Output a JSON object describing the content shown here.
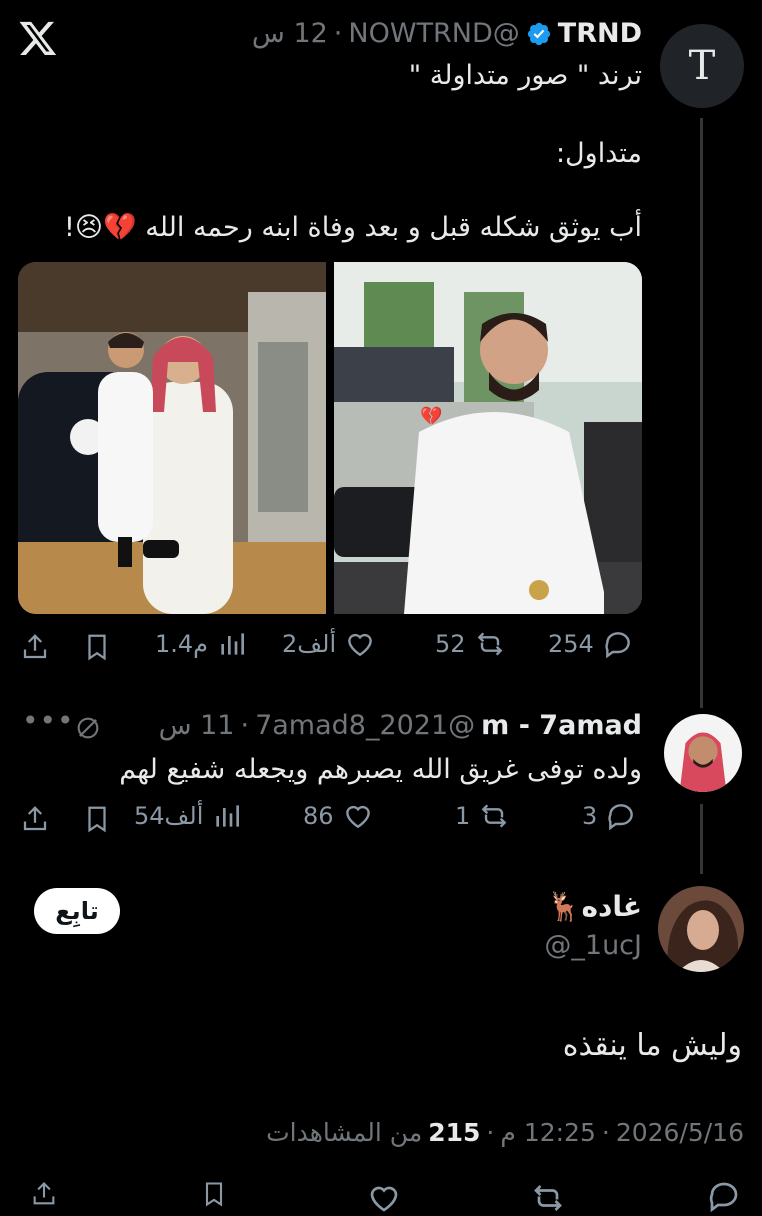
{
  "app": {
    "logo_icon": "x-logo-icon"
  },
  "colors": {
    "background": "#000000",
    "text": "#e7e9ea",
    "muted": "#71767b",
    "verified": "#1d9bf0",
    "heart_broken": "#f91880"
  },
  "tweet1": {
    "name": "TRND",
    "handle": "@NOWTRND",
    "sep": "·",
    "time": "12 س",
    "avatar_letter": "T",
    "lines": [
      "ترند \" صور متداولة \"",
      "متداول:",
      "أب يوثق شكله قبل و بعد وفاة ابنه رحمه الله 💔😣!"
    ],
    "actions": {
      "replies": "254",
      "reposts": "52",
      "likes": "2ألف",
      "views": "1.4م"
    }
  },
  "tweet2": {
    "name": "m - 7amad",
    "handle": "@7amad8_2021",
    "sep": "·",
    "time": "11 س",
    "text": "ولده توفى غريق الله يصبرهم ويجعله شفيع لهم",
    "actions": {
      "replies": "3",
      "reposts": "1",
      "likes": "86",
      "views": "54ألف"
    }
  },
  "main_tweet": {
    "name": "غاده🦌",
    "handle": "@_1ucJ",
    "follow_label": "تابِع",
    "text": "وليش ما ينقذه",
    "date": "2026/5/16",
    "time": "12:25 م",
    "views_count": "215",
    "views_label": "من المشاهدات",
    "sep": "·"
  }
}
